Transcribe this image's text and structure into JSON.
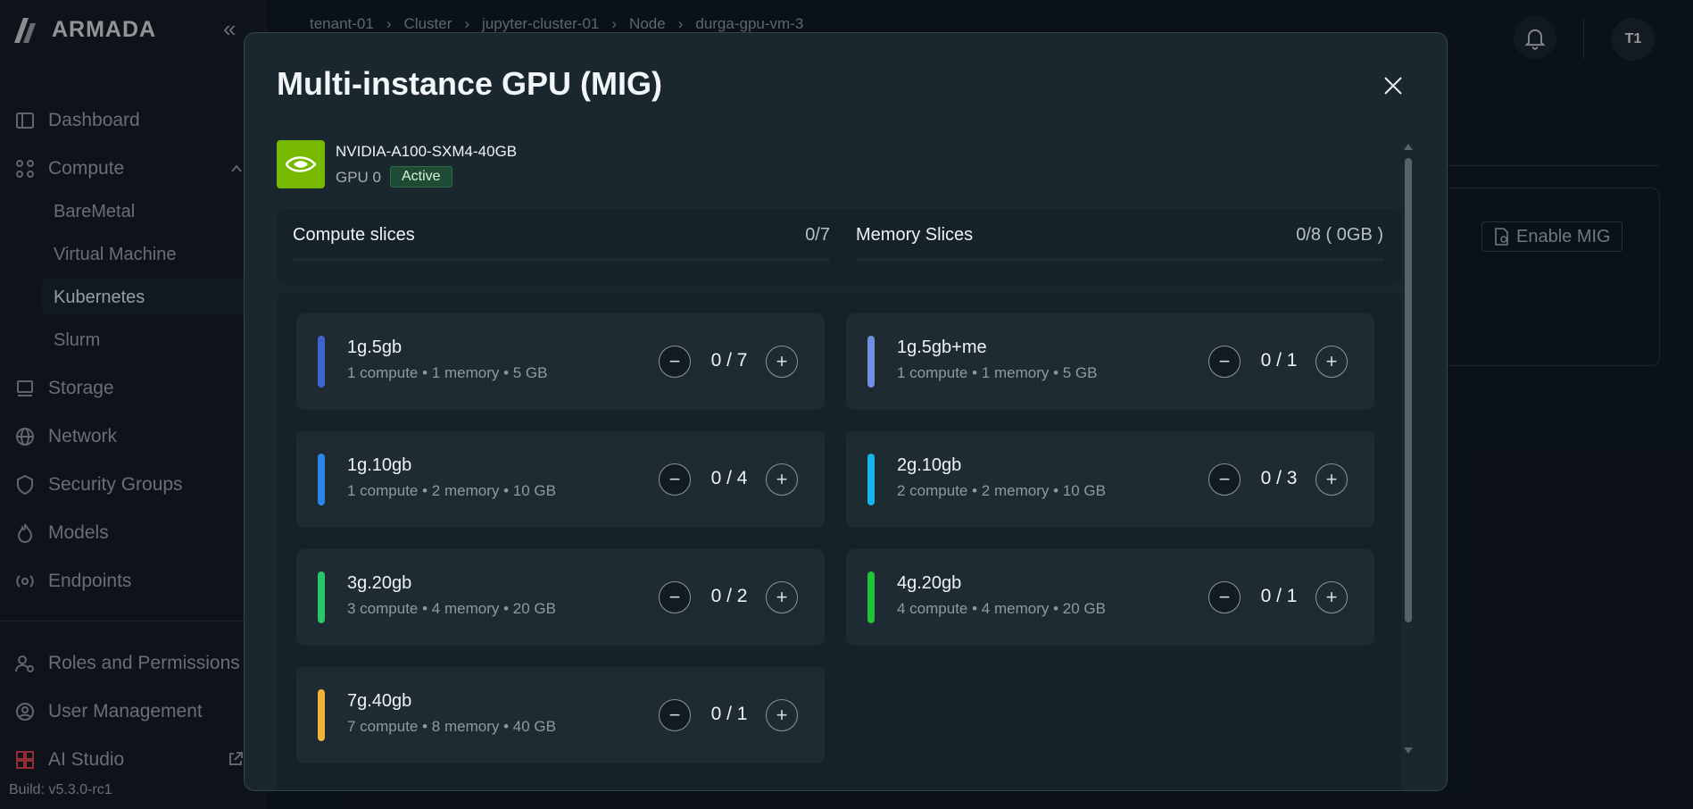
{
  "brand": {
    "name": "ARMADA"
  },
  "sidebar": {
    "items": [
      {
        "label": "Dashboard",
        "icon": "dashboard-icon"
      },
      {
        "label": "Compute",
        "icon": "compute-icon"
      },
      {
        "label": "Storage",
        "icon": "storage-icon"
      },
      {
        "label": "Network",
        "icon": "network-icon"
      },
      {
        "label": "Security Groups",
        "icon": "shield-icon"
      },
      {
        "label": "Models",
        "icon": "flame-icon"
      },
      {
        "label": "Endpoints",
        "icon": "broadcast-icon"
      },
      {
        "label": "Roles and Permissions",
        "icon": "roles-icon"
      },
      {
        "label": "User Management",
        "icon": "user-icon"
      },
      {
        "label": "AI Studio",
        "icon": "grid-icon"
      }
    ],
    "compute_sub": [
      "BareMetal",
      "Virtual Machine",
      "Kubernetes",
      "Slurm"
    ],
    "active_sub": "Kubernetes",
    "build": "Build: v5.3.0-rc1"
  },
  "breadcrumb": [
    "tenant-01",
    "Cluster",
    "jupyter-cluster-01",
    "Node",
    "durga-gpu-vm-3"
  ],
  "header": {
    "avatar": "T1"
  },
  "background": {
    "enable_mig_label": "Enable MIG"
  },
  "modal": {
    "title": "Multi-instance GPU (MIG)",
    "gpu": {
      "name": "NVIDIA-A100-SXM4-40GB",
      "index": "GPU 0",
      "status": "Active"
    },
    "summary": {
      "compute_label": "Compute slices",
      "compute_count": "0/7",
      "memory_label": "Memory Slices",
      "memory_count": "0/8 ( 0GB )"
    },
    "profiles": [
      {
        "name": "1g.5gb",
        "desc": "1 compute • 1 memory • 5 GB",
        "count": "0 / 7",
        "color": "#3f63d1"
      },
      {
        "name": "1g.5gb+me",
        "desc": "1 compute • 1 memory • 5 GB",
        "count": "0 / 1",
        "color": "#6f8fe0"
      },
      {
        "name": "1g.10gb",
        "desc": "1 compute • 2 memory • 10 GB",
        "count": "0 / 4",
        "color": "#2a86e8"
      },
      {
        "name": "2g.10gb",
        "desc": "2 compute • 2 memory • 10 GB",
        "count": "0 / 3",
        "color": "#16b6ec"
      },
      {
        "name": "3g.20gb",
        "desc": "3 compute • 4 memory • 20 GB",
        "count": "0 / 2",
        "color": "#29c56b"
      },
      {
        "name": "4g.20gb",
        "desc": "4 compute • 4 memory • 20 GB",
        "count": "0 / 1",
        "color": "#22c23a"
      },
      {
        "name": "7g.40gb",
        "desc": "7 compute • 8 memory • 40 GB",
        "count": "0 / 1",
        "color": "#f2b33a"
      }
    ]
  }
}
